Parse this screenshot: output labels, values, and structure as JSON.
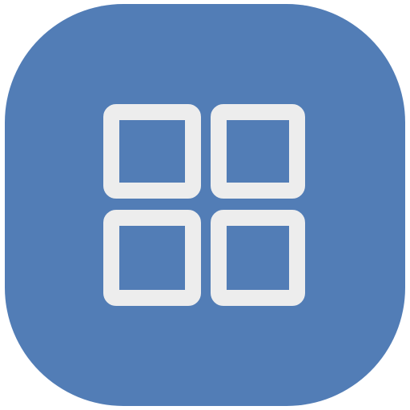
{
  "icon": {
    "name": "grid-icon",
    "background_color": "#527db6",
    "glyph_color": "#ededed",
    "cells": [
      "top-left",
      "top-right",
      "bottom-left",
      "bottom-right"
    ]
  }
}
